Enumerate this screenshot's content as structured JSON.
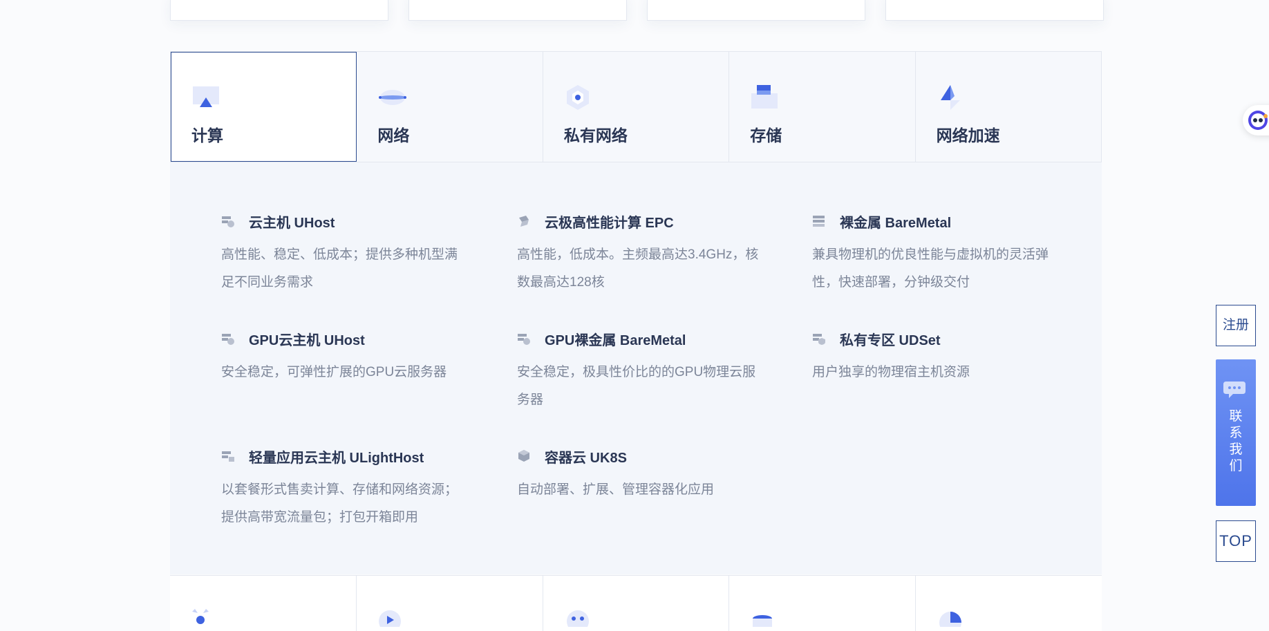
{
  "tabs": [
    {
      "label": "计算",
      "icon": "compute-icon",
      "active": true
    },
    {
      "label": "网络",
      "icon": "network-icon",
      "active": false
    },
    {
      "label": "私有网络",
      "icon": "private-network-icon",
      "active": false
    },
    {
      "label": "存储",
      "icon": "storage-icon",
      "active": false
    },
    {
      "label": "网络加速",
      "icon": "network-acceleration-icon",
      "active": false
    }
  ],
  "products": [
    {
      "title": "云主机 UHost",
      "desc": "高性能、稳定、低成本；提供多种机型满足不同业务需求",
      "icon": "server-cloud-icon"
    },
    {
      "title": "云极高性能计算 EPC",
      "desc": "高性能，低成本。主频最高达3.4GHz，核数最高达128核",
      "icon": "layers-icon"
    },
    {
      "title": "裸金属 BareMetal",
      "desc": "兼具物理机的优良性能与虚拟机的灵活弹性，快速部署，分钟级交付",
      "icon": "server-rack-icon"
    },
    {
      "title": "GPU云主机 UHost",
      "desc": "安全稳定，可弹性扩展的GPU云服务器",
      "icon": "server-cloud-icon"
    },
    {
      "title": "GPU裸金属 BareMetal",
      "desc": "安全稳定，极具性价比的的GPU物理云服务器",
      "icon": "server-cloud-icon"
    },
    {
      "title": "私有专区 UDSet",
      "desc": "用户独享的物理宿主机资源",
      "icon": "server-shield-icon"
    },
    {
      "title": "轻量应用云主机 ULightHost",
      "desc": "以套餐形式售卖计算、存储和网络资源；提供高带宽流量包；打包开箱即用",
      "icon": "server-light-icon"
    },
    {
      "title": "容器云 UK8S",
      "desc": "自动部署、扩展、管理容器化应用",
      "icon": "container-icon"
    }
  ],
  "float": {
    "register": "注册",
    "contact": "联系我们",
    "top": "TOP"
  },
  "colors": {
    "accent": "#2a4a8f",
    "brand_blue": "#4e74ea",
    "text_dark": "#2a3654",
    "text_gray": "#7c8598",
    "panel_bg": "#f3f6fb"
  }
}
